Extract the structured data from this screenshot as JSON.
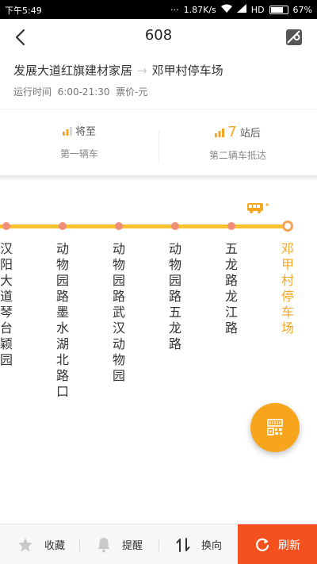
{
  "status_bar": {
    "time": "下午5:49",
    "network_speed": "1.87K/s",
    "network_type": "HD",
    "battery": "67%"
  },
  "header": {
    "title": "608"
  },
  "route": {
    "from": "发展大道红旗建材家居",
    "arrow": "→",
    "to": "邓甲村停车场",
    "hours_label": "运行时间",
    "hours": "6:00-21:30",
    "fare": "票价-元"
  },
  "arrival": {
    "first": {
      "status": "将至",
      "caption": "第一辆车"
    },
    "second": {
      "count": "7",
      "unit": "站后",
      "caption": "第二辆车抵达"
    }
  },
  "stations": [
    {
      "name": "汉阳大道琴台颖园",
      "current": false
    },
    {
      "name": "动物园路墨水湖北路口",
      "current": false
    },
    {
      "name": "动物园路武汉动物园",
      "current": false
    },
    {
      "name": "动物园路五龙路",
      "current": false
    },
    {
      "name": "五龙路龙江路",
      "current": false
    },
    {
      "name": "邓甲村停车场",
      "current": true
    }
  ],
  "toolbar": {
    "favorite_label": "收藏",
    "remind_label": "提醒",
    "switch_label": "换向",
    "refresh_label": "刷新"
  },
  "colors": {
    "accent_orange": "#f5a623",
    "line_yellow": "#f8c22f",
    "refresh_red": "#f4511e"
  }
}
